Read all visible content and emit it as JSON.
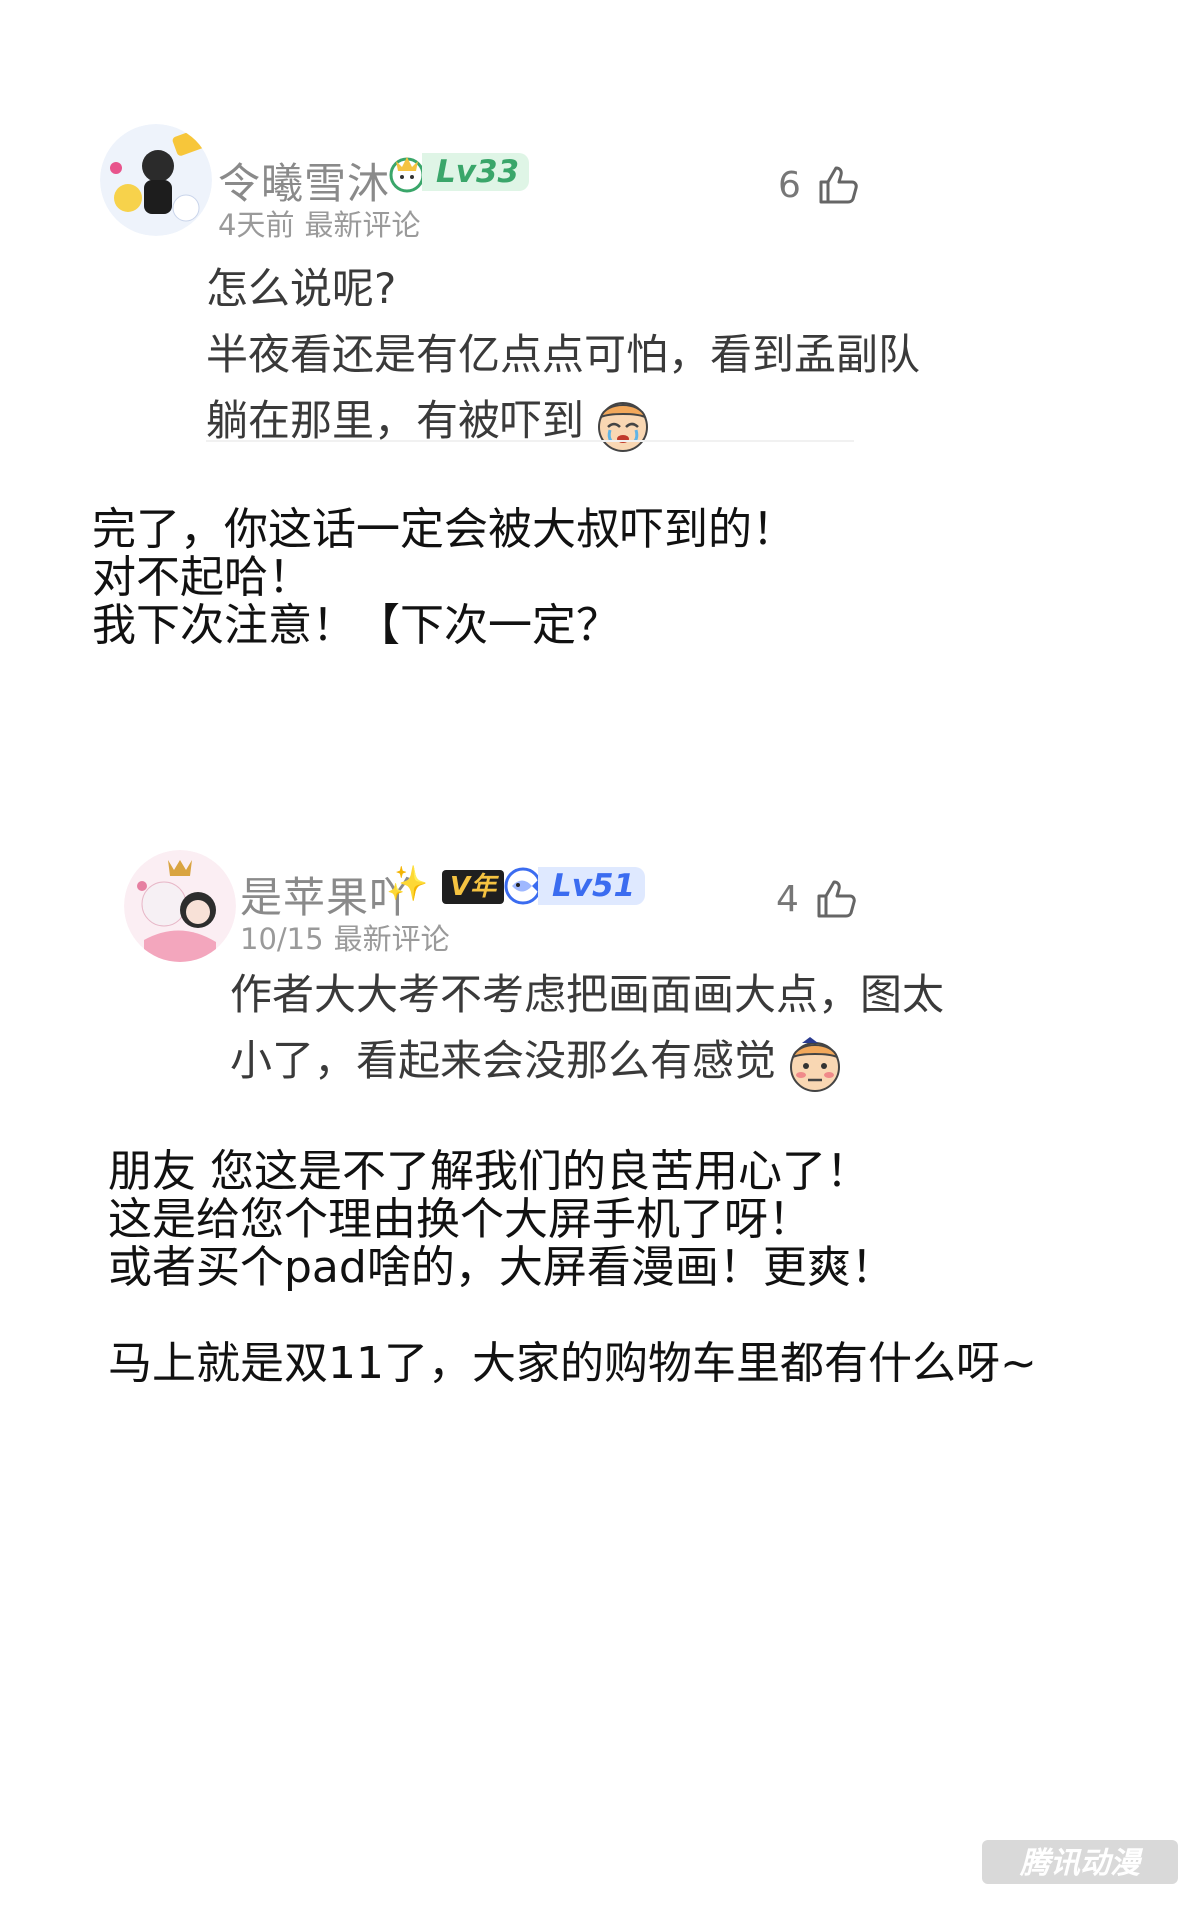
{
  "comments": [
    {
      "username": "令曦雪沐",
      "level": "Lv33",
      "time": "4天前",
      "tag": "最新评论",
      "likes": "6",
      "lines": [
        "怎么说呢?",
        "半夜看还是有亿点点可怕，看到孟副队",
        "躺在那里，有被吓到"
      ]
    },
    {
      "username": "是苹果吖",
      "vip_badge": "V年",
      "level": "Lv51",
      "time": "10/15",
      "tag": "最新评论",
      "likes": "4",
      "lines": [
        "作者大大考不考虑把画面画大点，图太",
        "小了，看起来会没那么有感觉"
      ]
    }
  ],
  "replies": [
    {
      "lines": [
        "完了，你这话一定会被大叔吓到的！",
        "对不起哈！",
        "我下次注意！【下次一定？"
      ]
    },
    {
      "lines": [
        "朋友 您这是不了解我们的良苦用心了！",
        "这是给您个理由换个大屏手机了呀！",
        "或者买个pad啥的，大屏看漫画！更爽！"
      ],
      "extra": "马上就是双11了，大家的购物车里都有什么呀~"
    }
  ],
  "watermark": "腾讯动漫",
  "colors": {
    "username": "#8a8a8a",
    "meta": "#9a9a9a",
    "lv33": "#3aa66a",
    "lv51": "#3b6cf0",
    "vip": "#f5c341"
  }
}
